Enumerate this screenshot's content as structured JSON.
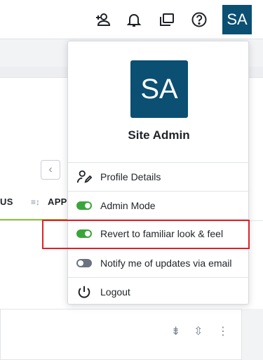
{
  "header": {
    "icons": [
      "add-user-icon",
      "bell-icon",
      "windows-icon",
      "help-icon"
    ],
    "avatar_initials": "SA"
  },
  "background": {
    "pager_prev_glyph": "‹",
    "column_left_partial": "US",
    "column_right_partial": "APPI"
  },
  "menu": {
    "avatar_initials": "SA",
    "user_name": "Site Admin",
    "items": [
      {
        "label": "Profile Details",
        "icon": "profile-edit-icon"
      },
      {
        "label": "Admin Mode",
        "icon": "toggle-on-icon",
        "toggle": "on"
      },
      {
        "label": "Revert to familiar look & feel",
        "icon": "toggle-on-icon",
        "toggle": "on"
      },
      {
        "label": "Notify me of updates via email",
        "icon": "toggle-off-icon",
        "toggle": "off"
      },
      {
        "label": "Logout",
        "icon": "power-icon"
      }
    ]
  },
  "colors": {
    "avatar_bg": "#0b4f73",
    "toggle_on": "#3aa53a",
    "toggle_off": "#6b7380",
    "highlight": "#e0202a",
    "tab_underline": "#8dc63f"
  }
}
